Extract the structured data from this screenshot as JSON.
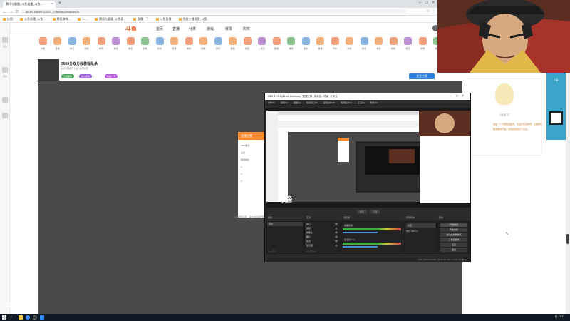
{
  "browser": {
    "tab_title": "腾讯与霸霸_斗鱼直播_斗鱼...",
    "url": "douyu.com/9713237_i=5d56b12b9634629",
    "bookmarks": [
      "应用",
      "斗鱼直播_斗鱼...",
      "腾讯游戏...",
      "\"m...",
      "腾讯与霸霸_斗鱼直...",
      "直播一下",
      "斗鱼直播",
      "华夏主播直播_斗鱼..."
    ]
  },
  "douyu": {
    "logo": "斗鱼",
    "nav": [
      "首页",
      "直播",
      "分类",
      "游戏",
      "赛事",
      "购买"
    ],
    "rail": [
      "关注",
      "历史"
    ],
    "categories": [
      "分类",
      "直播",
      "热门",
      "活动",
      "娱乐",
      "游戏",
      "电竞",
      "户外",
      "科技",
      "手游",
      "单机",
      "网游",
      "音乐",
      "舞蹈",
      "颜值",
      "二次元",
      "星秀",
      "体育",
      "美食",
      "旅游",
      "汽车",
      "数码",
      "知识",
      "情感",
      "影视",
      "综艺",
      "纪录",
      "教育",
      "财经"
    ],
    "stream": {
      "title": "5000分双分段教程乱杀",
      "meta": "腾讯与霸霸 · 分类: 腾讯游戏",
      "badges": [
        "王者荣耀",
        "腾讯游戏",
        "直播一下"
      ],
      "follow_label": "关注主播"
    },
    "dialog": {
      "header": "直播设置",
      "lines": [
        "OBS推流",
        "设置",
        "推流地址",
        "1.",
        "2.",
        "3."
      ]
    },
    "player_caption": "OBS推流设置，请在OBS中配置推流码",
    "notice_caption": "没有更多了",
    "notice_text": "这是一个不错的直播间，欢迎大家来捧场！主播每天都会准时开播，喜欢的话请点个关注。"
  },
  "obs": {
    "title": "OBS 27.0.1 (64-bit, windows) - 配置文件: 未命名 - 场景: 未命名",
    "menu": [
      "文件(F)",
      "编辑(E)",
      "视图(V)",
      "停靠窗口(D)",
      "配置文件(P)",
      "场景集合(S)",
      "工具(T)",
      "帮助(H)"
    ],
    "modes": [
      "预览",
      "节目"
    ],
    "dock_titles": [
      "场景",
      "来源",
      "混音器",
      "转场特效",
      "控件"
    ],
    "scenes": [
      "场景"
    ],
    "sources": [
      "窗口",
      "游戏",
      "摄像头",
      "图片",
      "文字",
      "显示器"
    ],
    "mixer": [
      "桌面音频",
      "麦克风/Aux"
    ],
    "transition": [
      "淡出",
      "时长 300 ms"
    ],
    "controls": [
      "开始推流",
      "开始录制",
      "启动虚拟摄像机",
      "工作室模式",
      "设置",
      "退出"
    ],
    "status": "LIVE: 00:00:00   REC: 00:00:00   CPU: 1.5%, 60.00 fps"
  },
  "taskbar": {
    "clock": "13:40",
    "tray": "英"
  },
  "watermark": "斗鱼",
  "colors": {
    "douyu_orange": "#ff5d23",
    "obs_bg": "#2b2b2b",
    "taskbar": "#101a24"
  }
}
